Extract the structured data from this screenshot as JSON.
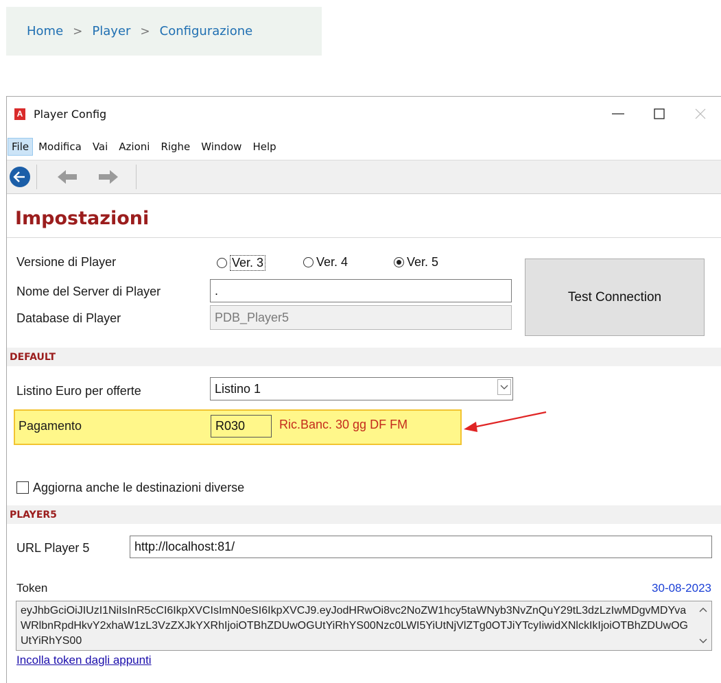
{
  "breadcrumb": {
    "items": [
      "Home",
      "Player",
      "Configurazione"
    ],
    "separator": ">"
  },
  "window": {
    "title": "Player Config",
    "app_icon": "A",
    "controls": {
      "minimize": "—",
      "maximize": "☐",
      "close": "✕"
    }
  },
  "menu": [
    "File",
    "Modifica",
    "Vai",
    "Azioni",
    "Righe",
    "Window",
    "Help"
  ],
  "toolbar": {
    "icons": [
      "back-circle-icon",
      "arrow-left-icon",
      "arrow-right-icon"
    ]
  },
  "section_title": "Impostazioni",
  "form": {
    "version_label": "Versione di Player",
    "versions": [
      "Ver. 3",
      "Ver. 4",
      "Ver. 5"
    ],
    "selected_version": "Ver. 5",
    "server_label": "Nome del Server di Player",
    "server_value": ".",
    "database_label": "Database di Player",
    "database_value": "PDB_Player5",
    "test_button": "Test Connection"
  },
  "default_section": {
    "heading": "DEFAULT",
    "listino_label": "Listino Euro per offerte",
    "listino_value": "Listino 1",
    "pagamento_label": "Pagamento",
    "pagamento_code": "R030",
    "pagamento_desc": "Ric.Banc. 30 gg DF FM",
    "checkbox_label": "Aggiorna anche le destinazioni diverse",
    "checkbox_checked": false
  },
  "player5_section": {
    "heading": "PLAYER5",
    "url_label": "URL Player 5",
    "url_value": "http://localhost:81/",
    "token_label": "Token",
    "token_date": "30-08-2023",
    "token_value": "eyJhbGciOiJIUzI1NiIsInR5cCI6IkpXVCIsImN0eSI6IkpXVCJ9.eyJodHRwOi8vc2NoZW1hcy5taWNyb3NvZnQuY29tL3dzLzIwMDgvMDYvaWRlbnRpdHkvY2xhaW1zL3VzZXJkYXRhIjoiOTBhZDUwOGUtYiRhYS00Nzc0LWI5YiUtNjVlZTg0OTJiYTcyIiwidXNlckIkIjoiOTBhZDUwOGUtYiRhYS00",
    "paste_link": "Incolla token dagli appunti"
  },
  "colors": {
    "accent": "#9b1d1d",
    "link": "#1f6fb2",
    "highlight": "#fff78a",
    "annotation_arrow": "#e02424"
  }
}
